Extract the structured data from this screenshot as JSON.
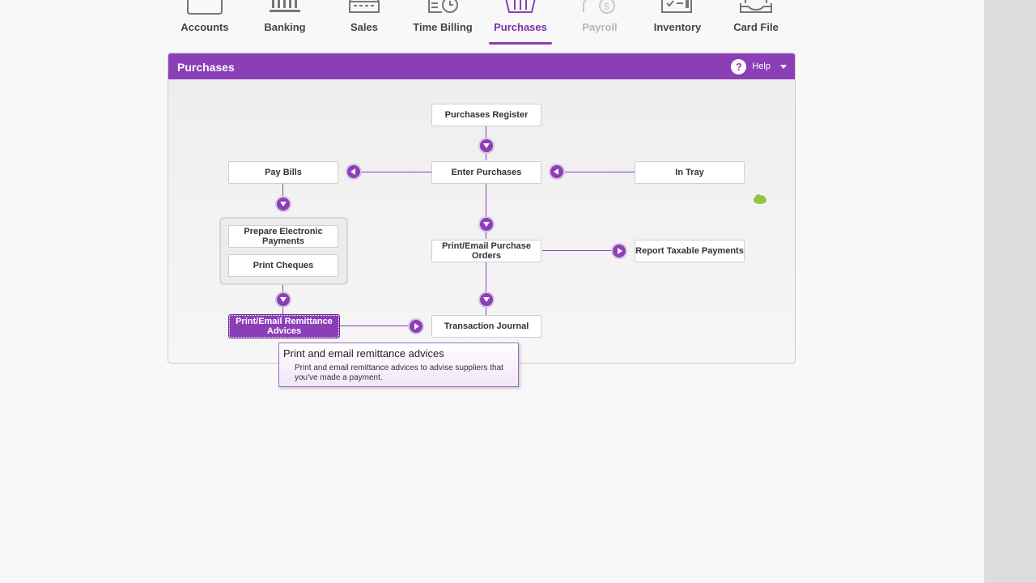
{
  "nav": {
    "tabs": [
      {
        "label": "Accounts",
        "icon": "folder-icon",
        "state": "normal"
      },
      {
        "label": "Banking",
        "icon": "bank-icon",
        "state": "normal"
      },
      {
        "label": "Sales",
        "icon": "cash-register-icon",
        "state": "normal"
      },
      {
        "label": "Time Billing",
        "icon": "time-billing-icon",
        "state": "normal"
      },
      {
        "label": "Purchases",
        "icon": "basket-icon",
        "state": "active"
      },
      {
        "label": "Payroll",
        "icon": "payroll-icon",
        "state": "disabled"
      },
      {
        "label": "Inventory",
        "icon": "inventory-icon",
        "state": "normal"
      },
      {
        "label": "Card File",
        "icon": "card-file-icon",
        "state": "normal"
      }
    ]
  },
  "panel": {
    "title": "Purchases",
    "help_label": "Help",
    "help_icon_text": "?"
  },
  "flow": {
    "purchases_register": "Purchases Register",
    "enter_purchases": "Enter Purchases",
    "in_tray": "In Tray",
    "pay_bills": "Pay Bills",
    "prepare_electronic_payments": "Prepare Electronic Payments",
    "print_cheques": "Print Cheques",
    "print_email_purchase_orders": "Print/Email Purchase Orders",
    "report_taxable_payments": "Report Taxable Payments",
    "print_email_remittance_advices": "Print/Email Remittance Advices",
    "transaction_journal": "Transaction Journal"
  },
  "tooltip": {
    "title": "Print and email remittance advices",
    "text": "Print and email remittance advices to advise suppliers that you've made a payment."
  },
  "colors": {
    "accent": "#8b3fb7",
    "cloud": "#8dc63f"
  }
}
